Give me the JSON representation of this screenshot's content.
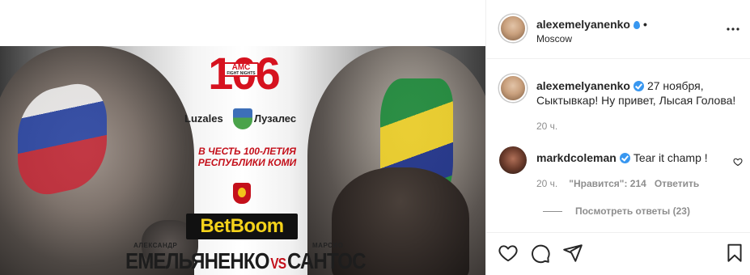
{
  "poster": {
    "event_number": "106",
    "brand": "AMC",
    "brand_sub": "FIGHT NIGHTS",
    "sponsor_left": "Luzales",
    "sponsor_right": "Лузалес",
    "tagline": "В честь 100-летия республики Коми",
    "betting_sponsor": "BetBoom",
    "fighter1_first": "АЛЕКСАНДР",
    "fighter1_last": "ЕМЕЛЬЯНЕНКО",
    "vs": "VS",
    "fighter2_first": "МАРСИО",
    "fighter2_last": "САНТОС"
  },
  "header": {
    "username": "alexemelyanenko",
    "dot": "•",
    "location": "Moscow",
    "more_icon": "more-horizontal-icon"
  },
  "caption": {
    "username": "alexemelyanenko",
    "date": "27 ноября,",
    "text": "Сыктывкар! Ну привет, Лысая Голова!",
    "time": "20 ч."
  },
  "comment": {
    "username": "markdcoleman",
    "text": "Tear it champ !",
    "time": "20 ч.",
    "likes": "\"Нравится\": 214",
    "reply": "Ответить",
    "view_replies": "Посмотреть ответы (23)"
  },
  "actions": {
    "like_icon": "heart-icon",
    "comment_icon": "comment-icon",
    "share_icon": "paper-plane-icon",
    "save_icon": "bookmark-icon"
  },
  "colors": {
    "verified": "#3897f0",
    "text": "#262626",
    "muted": "#8e8e8e",
    "poster_red": "#d6121f",
    "betboom_yellow": "#f4d21a"
  }
}
